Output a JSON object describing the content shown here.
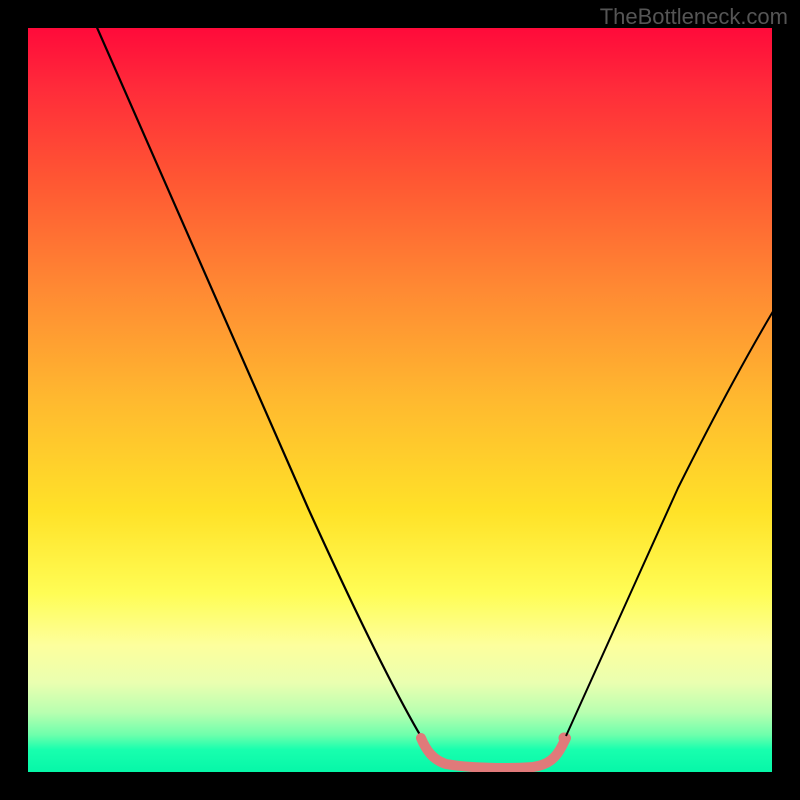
{
  "watermark": "TheBottleneck.com",
  "chart_data": {
    "type": "line",
    "title": "",
    "xlabel": "",
    "ylabel": "",
    "xlim": [
      0,
      100
    ],
    "ylim": [
      0,
      100
    ],
    "grid": false,
    "legend": false,
    "background": "rainbow-gradient-vertical",
    "series": [
      {
        "name": "left-curve",
        "color": "#000000",
        "x": [
          9,
          15,
          20,
          25,
          30,
          35,
          40,
          45,
          50,
          52
        ],
        "y": [
          100,
          88,
          78,
          68,
          58,
          48,
          38,
          26,
          10,
          4
        ]
      },
      {
        "name": "pink-bottom-segment",
        "color": "#e07a7a",
        "thickness": 9,
        "x": [
          52,
          53,
          55,
          58,
          61,
          64,
          67,
          70,
          71,
          72
        ],
        "y": [
          4,
          2,
          1,
          0.5,
          0.5,
          0.5,
          1,
          2,
          3,
          4
        ]
      },
      {
        "name": "right-curve",
        "color": "#000000",
        "x": [
          72,
          75,
          78,
          81,
          84,
          87,
          90,
          93,
          96,
          100
        ],
        "y": [
          4,
          10,
          18,
          26,
          34,
          42,
          50,
          57,
          62,
          64
        ]
      }
    ],
    "annotations": [
      {
        "type": "dot",
        "x": 71.5,
        "y": 4,
        "color": "#e07a7a",
        "radius": 5
      }
    ]
  }
}
